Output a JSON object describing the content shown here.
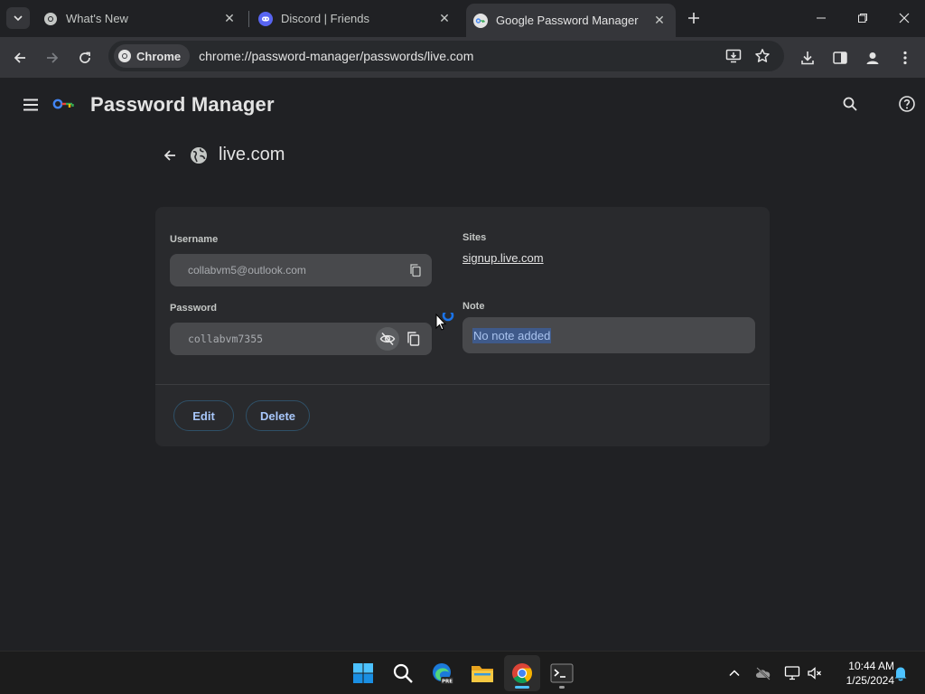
{
  "tabs": [
    {
      "title": "What's New",
      "icon": "chrome-icon",
      "active": false
    },
    {
      "title": "Discord | Friends",
      "icon": "discord-icon",
      "active": false
    },
    {
      "title": "Google Password Manager",
      "icon": "password-manager-icon",
      "active": true
    }
  ],
  "omnibox": {
    "chip_label": "Chrome",
    "url_host": "chrome://password-manager",
    "url_path": "/passwords/live.com"
  },
  "app": {
    "title": "Password Manager"
  },
  "detail": {
    "site_title": "live.com",
    "username_label": "Username",
    "username_value": "collabvm5@outlook.com",
    "password_label": "Password",
    "password_value": "collabvm7355",
    "sites_label": "Sites",
    "site_link": "signup.live.com",
    "note_label": "Note",
    "note_value": "No note added",
    "edit_label": "Edit",
    "delete_label": "Delete"
  },
  "taskbar": {
    "time": "10:44 AM",
    "date": "1/25/2024",
    "apps": [
      "start-icon",
      "search-icon",
      "edge-beta-icon",
      "file-explorer-icon",
      "chrome-icon",
      "terminal-icon"
    ]
  },
  "colors": {
    "accent": "#a8c7fa",
    "selection": "#3f5a8a",
    "page_bg": "#202124",
    "card_bg": "#292a2d"
  }
}
